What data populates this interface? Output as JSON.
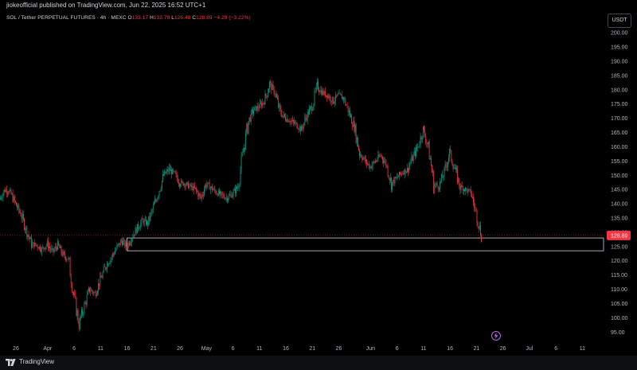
{
  "header": {
    "published": "jiokeofficial published on TradingView.com, Jun 22, 2025 16:52 UTC+1"
  },
  "symbol": {
    "name": "SOL / Tether PERPETUAL FUTURES · 4h · MEXC",
    "o_label": "O",
    "o_value": "133.17",
    "h_label": "H",
    "h_value": "133.79",
    "l_label": "L",
    "l_value": "126.48",
    "c_label": "C",
    "c_value": "128.89",
    "change": "−4.29 (−3.22%)"
  },
  "currency_button": "USDT",
  "footer": {
    "brand": "TradingView"
  },
  "colors": {
    "up": "#089981",
    "down": "#f23645",
    "price_tag": "#f23645",
    "zone_border": "#d1d4dc"
  },
  "icons": {
    "logo": "tradingview-logo-icon",
    "flash": "lightning-icon"
  },
  "chart_data": {
    "type": "candlestick",
    "interval": "4h",
    "ylim": [
      92,
      202
    ],
    "yticks": [
      95,
      100,
      105,
      110,
      115,
      120,
      125,
      130,
      135,
      140,
      145,
      150,
      155,
      160,
      165,
      170,
      175,
      180,
      185,
      190,
      195,
      200
    ],
    "ytick_labels": [
      "95.00",
      "100.00",
      "105.00",
      "110.00",
      "115.00",
      "120.00",
      "125.00",
      "130.00",
      "135.00",
      "140.00",
      "145.00",
      "150.00",
      "155.00",
      "160.00",
      "165.00",
      "170.00",
      "175.00",
      "180.00",
      "185.00",
      "190.00",
      "195.00",
      "200.00"
    ],
    "xlim": [
      "2025-03-23",
      "2025-07-15"
    ],
    "xticks": [
      {
        "date": "2025-03-26",
        "label": "26"
      },
      {
        "date": "2025-04-01",
        "label": "Apr"
      },
      {
        "date": "2025-04-06",
        "label": "6"
      },
      {
        "date": "2025-04-11",
        "label": "11"
      },
      {
        "date": "2025-04-16",
        "label": "16"
      },
      {
        "date": "2025-04-21",
        "label": "21"
      },
      {
        "date": "2025-04-26",
        "label": "26"
      },
      {
        "date": "2025-05-01",
        "label": "May"
      },
      {
        "date": "2025-05-06",
        "label": "6"
      },
      {
        "date": "2025-05-11",
        "label": "11"
      },
      {
        "date": "2025-05-16",
        "label": "16"
      },
      {
        "date": "2025-05-21",
        "label": "21"
      },
      {
        "date": "2025-05-26",
        "label": "26"
      },
      {
        "date": "2025-06-01",
        "label": "Jun"
      },
      {
        "date": "2025-06-06",
        "label": "6"
      },
      {
        "date": "2025-06-11",
        "label": "11"
      },
      {
        "date": "2025-06-16",
        "label": "16"
      },
      {
        "date": "2025-06-21",
        "label": "21"
      },
      {
        "date": "2025-06-26",
        "label": "26"
      },
      {
        "date": "2025-07-01",
        "label": "Jul"
      },
      {
        "date": "2025-07-06",
        "label": "6"
      },
      {
        "date": "2025-07-11",
        "label": "11"
      }
    ],
    "last_price": 128.89,
    "last_price_label": "128.89",
    "last_date": "2025-06-22",
    "zone": {
      "from_date": "2025-04-16",
      "to_date": "2025-07-15",
      "low": 123.5,
      "high": 128.0
    },
    "closes": [
      {
        "date": "2025-03-23",
        "close": 141.5
      },
      {
        "date": "2025-03-24",
        "close": 145.0
      },
      {
        "date": "2025-03-25",
        "close": 144.0
      },
      {
        "date": "2025-03-26",
        "close": 140.0
      },
      {
        "date": "2025-03-27",
        "close": 136.5
      },
      {
        "date": "2025-03-28",
        "close": 131.0
      },
      {
        "date": "2025-03-29",
        "close": 126.0
      },
      {
        "date": "2025-03-30",
        "close": 125.5
      },
      {
        "date": "2025-03-31",
        "close": 124.0
      },
      {
        "date": "2025-04-01",
        "close": 126.0
      },
      {
        "date": "2025-04-02",
        "close": 123.0
      },
      {
        "date": "2025-04-03",
        "close": 125.5
      },
      {
        "date": "2025-04-04",
        "close": 122.0
      },
      {
        "date": "2025-04-05",
        "close": 120.5
      },
      {
        "date": "2025-04-06",
        "close": 108.0
      },
      {
        "date": "2025-04-07",
        "close": 98.0
      },
      {
        "date": "2025-04-08",
        "close": 104.0
      },
      {
        "date": "2025-04-09",
        "close": 110.0
      },
      {
        "date": "2025-04-10",
        "close": 108.5
      },
      {
        "date": "2025-04-11",
        "close": 113.0
      },
      {
        "date": "2025-04-12",
        "close": 118.0
      },
      {
        "date": "2025-04-13",
        "close": 121.0
      },
      {
        "date": "2025-04-14",
        "close": 124.0
      },
      {
        "date": "2025-04-15",
        "close": 127.0
      },
      {
        "date": "2025-04-16",
        "close": 125.0
      },
      {
        "date": "2025-04-17",
        "close": 128.5
      },
      {
        "date": "2025-04-18",
        "close": 131.5
      },
      {
        "date": "2025-04-19",
        "close": 134.0
      },
      {
        "date": "2025-04-20",
        "close": 133.0
      },
      {
        "date": "2025-04-21",
        "close": 138.5
      },
      {
        "date": "2025-04-22",
        "close": 144.0
      },
      {
        "date": "2025-04-23",
        "close": 150.0
      },
      {
        "date": "2025-04-24",
        "close": 152.0
      },
      {
        "date": "2025-04-25",
        "close": 150.5
      },
      {
        "date": "2025-04-26",
        "close": 147.5
      },
      {
        "date": "2025-04-27",
        "close": 147.0
      },
      {
        "date": "2025-04-28",
        "close": 146.0
      },
      {
        "date": "2025-04-29",
        "close": 145.0
      },
      {
        "date": "2025-04-30",
        "close": 142.0
      },
      {
        "date": "2025-05-01",
        "close": 147.0
      },
      {
        "date": "2025-05-02",
        "close": 145.5
      },
      {
        "date": "2025-05-03",
        "close": 144.0
      },
      {
        "date": "2025-05-04",
        "close": 143.0
      },
      {
        "date": "2025-05-05",
        "close": 142.0
      },
      {
        "date": "2025-05-06",
        "close": 143.5
      },
      {
        "date": "2025-05-07",
        "close": 146.0
      },
      {
        "date": "2025-05-08",
        "close": 158.0
      },
      {
        "date": "2025-05-09",
        "close": 169.0
      },
      {
        "date": "2025-05-10",
        "close": 173.0
      },
      {
        "date": "2025-05-11",
        "close": 174.0
      },
      {
        "date": "2025-05-12",
        "close": 176.0
      },
      {
        "date": "2025-05-13",
        "close": 182.0
      },
      {
        "date": "2025-05-14",
        "close": 179.0
      },
      {
        "date": "2025-05-15",
        "close": 172.0
      },
      {
        "date": "2025-05-16",
        "close": 170.0
      },
      {
        "date": "2025-05-17",
        "close": 169.0
      },
      {
        "date": "2025-05-18",
        "close": 168.0
      },
      {
        "date": "2025-05-19",
        "close": 166.0
      },
      {
        "date": "2025-05-20",
        "close": 171.0
      },
      {
        "date": "2025-05-21",
        "close": 174.0
      },
      {
        "date": "2025-05-22",
        "close": 181.0
      },
      {
        "date": "2025-05-23",
        "close": 179.0
      },
      {
        "date": "2025-05-24",
        "close": 178.0
      },
      {
        "date": "2025-05-25",
        "close": 176.0
      },
      {
        "date": "2025-05-26",
        "close": 178.0
      },
      {
        "date": "2025-05-27",
        "close": 177.0
      },
      {
        "date": "2025-05-28",
        "close": 172.0
      },
      {
        "date": "2025-05-29",
        "close": 167.0
      },
      {
        "date": "2025-05-30",
        "close": 158.0
      },
      {
        "date": "2025-05-31",
        "close": 155.0
      },
      {
        "date": "2025-06-01",
        "close": 153.0
      },
      {
        "date": "2025-06-02",
        "close": 155.0
      },
      {
        "date": "2025-06-03",
        "close": 157.0
      },
      {
        "date": "2025-06-04",
        "close": 154.0
      },
      {
        "date": "2025-06-05",
        "close": 147.0
      },
      {
        "date": "2025-06-06",
        "close": 149.0
      },
      {
        "date": "2025-06-07",
        "close": 151.0
      },
      {
        "date": "2025-06-08",
        "close": 152.0
      },
      {
        "date": "2025-06-09",
        "close": 156.0
      },
      {
        "date": "2025-06-10",
        "close": 160.0
      },
      {
        "date": "2025-06-11",
        "close": 166.0
      },
      {
        "date": "2025-06-12",
        "close": 160.0
      },
      {
        "date": "2025-06-13",
        "close": 147.0
      },
      {
        "date": "2025-06-14",
        "close": 146.0
      },
      {
        "date": "2025-06-15",
        "close": 151.0
      },
      {
        "date": "2025-06-16",
        "close": 158.0
      },
      {
        "date": "2025-06-17",
        "close": 152.0
      },
      {
        "date": "2025-06-18",
        "close": 146.0
      },
      {
        "date": "2025-06-19",
        "close": 145.0
      },
      {
        "date": "2025-06-20",
        "close": 144.0
      },
      {
        "date": "2025-06-21",
        "close": 137.0
      },
      {
        "date": "2025-06-22",
        "close": 128.89
      }
    ]
  }
}
